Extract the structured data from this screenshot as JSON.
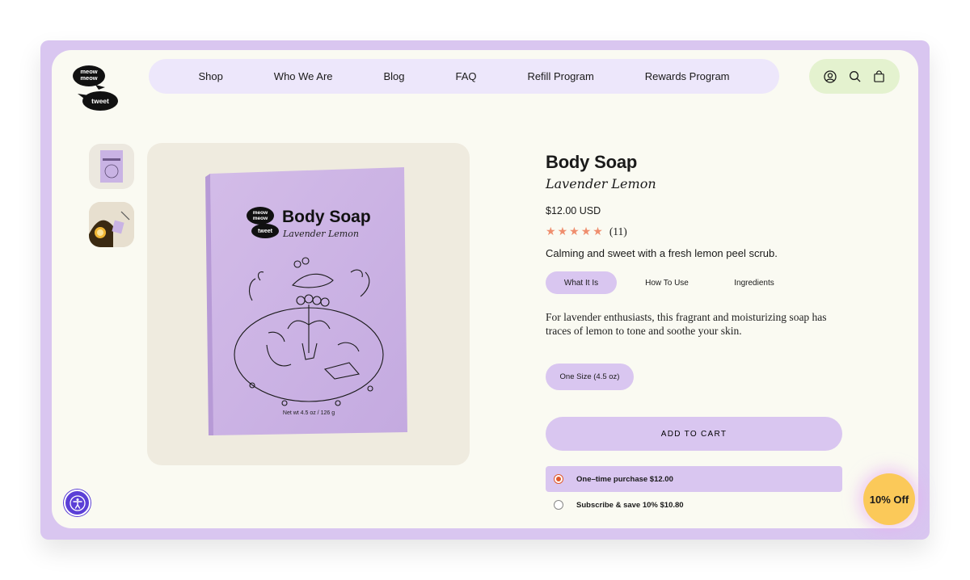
{
  "brand": {
    "logo_top": "meow meow",
    "logo_bottom": "tweet"
  },
  "nav": {
    "items": [
      {
        "label": "Shop"
      },
      {
        "label": "Who We Are"
      },
      {
        "label": "Blog"
      },
      {
        "label": "FAQ"
      },
      {
        "label": "Refill Program"
      },
      {
        "label": "Rewards Program"
      }
    ]
  },
  "header_icons": [
    "account-icon",
    "search-icon",
    "cart-icon"
  ],
  "product": {
    "title": "Body Soap",
    "subtitle": "Lavender Lemon",
    "price": "$12.00 USD",
    "rating": {
      "stars": 5,
      "count": "(11)"
    },
    "tagline": "Calming and sweet with a fresh lemon peel scrub.",
    "tabs": [
      {
        "label": "What It Is",
        "active": true
      },
      {
        "label": "How To Use",
        "active": false
      },
      {
        "label": "Ingredients",
        "active": false
      }
    ],
    "description": "For lavender enthusiasts, this fragrant and moisturizing soap has traces of lemon to tone and soothe your skin.",
    "size_option": "One Size (4.5 oz)",
    "add_to_cart": "ADD TO CART",
    "purchase_options": [
      {
        "label": "One–time purchase $12.00",
        "selected": true
      },
      {
        "label": "Subscribe & save 10% $10.80",
        "selected": false
      }
    ]
  },
  "box_art": {
    "title": "Body Soap",
    "subtitle": "Lavender Lemon",
    "weight": "Net wt 4.5 oz / 126 g",
    "logo_top": "meow meow",
    "logo_bottom": "tweet"
  },
  "discount_badge": "10% Off",
  "colors": {
    "accent_lavender": "#d9c6f0",
    "nav_bg": "#ede7fb",
    "icons_bg": "#e4f2cf",
    "page_bg": "#fafaf2",
    "star": "#ef8e6e",
    "badge": "#fbc959",
    "accessibility": "#5b3fd6"
  }
}
